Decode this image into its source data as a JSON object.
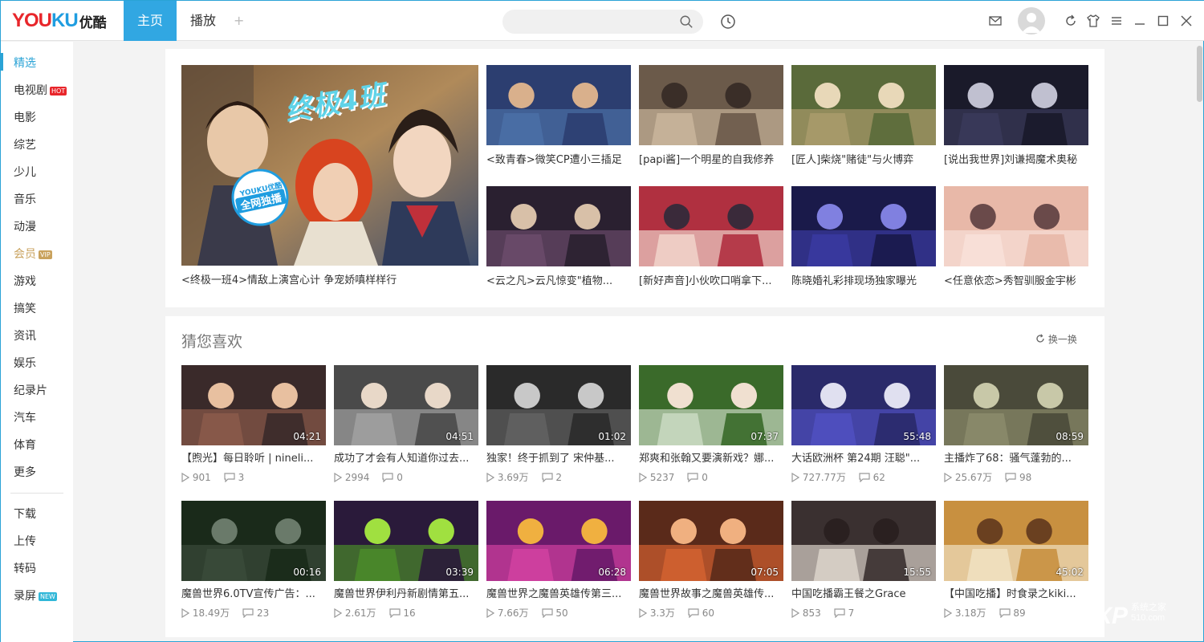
{
  "app": {
    "brand": "YOUKU",
    "brand_cn": "优酷",
    "tabs": [
      {
        "label": "主页",
        "active": true
      },
      {
        "label": "播放",
        "active": false
      }
    ],
    "add_tab": "+",
    "search_placeholder": ""
  },
  "sidebar": {
    "items": [
      {
        "label": "精选",
        "active": true
      },
      {
        "label": "电视剧",
        "badge": "HOT",
        "badge_color": "#e8262b"
      },
      {
        "label": "电影"
      },
      {
        "label": "综艺"
      },
      {
        "label": "少儿"
      },
      {
        "label": "音乐"
      },
      {
        "label": "动漫"
      },
      {
        "label": "会员",
        "badge": "VIP",
        "badge_color": "#c9a25d",
        "vip": true
      },
      {
        "label": "游戏"
      },
      {
        "label": "搞笑"
      },
      {
        "label": "资讯"
      },
      {
        "label": "娱乐"
      },
      {
        "label": "纪录片"
      },
      {
        "label": "汽车"
      },
      {
        "label": "体育"
      },
      {
        "label": "更多"
      },
      {
        "label": "下载"
      },
      {
        "label": "上传"
      },
      {
        "label": "转码"
      },
      {
        "label": "录屏",
        "badge": "NEW",
        "badge_color": "#31b7d8"
      }
    ]
  },
  "featured": {
    "hero": {
      "caption": "<终极一班4>情敌上演宫心计 争宠娇嗔样样行",
      "overlay_title": "终极4班",
      "stamp_top": "YOUKU优酷",
      "stamp_main": "全网独播"
    },
    "items": [
      {
        "caption": "<致青春>微笑CP遭小三插足"
      },
      {
        "caption": "[papi酱]一个明星的自我修养"
      },
      {
        "caption": "[匠人]柴烧\"赌徒\"与火博弈"
      },
      {
        "caption": "[说出我世界]刘谦揭魔术奥秘"
      },
      {
        "caption": "<云之凡>云凡惊变\"植物..."
      },
      {
        "caption": "[新好声音]小伙吹口哨拿下..."
      },
      {
        "caption": "陈晓婚礼彩排现场独家曝光"
      },
      {
        "caption": "<任意依恋>秀智驯服金宇彬"
      }
    ]
  },
  "recommend": {
    "title": "猜您喜欢",
    "refresh_label": "换一换",
    "videos": [
      {
        "title": "【煦光】每日聆听 | nineli...",
        "duration": "04:21",
        "views": "901",
        "comments": "3"
      },
      {
        "title": "成功了才会有人知道你过去...",
        "duration": "04:51",
        "views": "2994",
        "comments": "0"
      },
      {
        "title": "独家！终于抓到了 宋仲基...",
        "duration": "01:02",
        "views": "3.69万",
        "comments": "2"
      },
      {
        "title": "郑爽和张翰又要演新戏？娜...",
        "duration": "07:37",
        "views": "5237",
        "comments": "0"
      },
      {
        "title": "大话欧洲杯 第24期 汪聪\"...",
        "duration": "55:48",
        "views": "727.77万",
        "comments": "62"
      },
      {
        "title": "主播炸了68：骚气蓬勃的...",
        "duration": "08:59",
        "views": "25.67万",
        "comments": "98"
      },
      {
        "title": "魔兽世界6.0TV宣传广告：...",
        "duration": "00:16",
        "views": "18.49万",
        "comments": "23"
      },
      {
        "title": "魔兽世界伊利丹新剧情第五...",
        "duration": "03:39",
        "views": "2.61万",
        "comments": "16"
      },
      {
        "title": "魔兽世界之魔兽英雄传第三...",
        "duration": "06:28",
        "views": "7.66万",
        "comments": "50"
      },
      {
        "title": "魔兽世界故事之魔兽英雄传...",
        "duration": "07:05",
        "views": "3.3万",
        "comments": "60"
      },
      {
        "title": "中国吃播霸王餐之Grace",
        "duration": "15:55",
        "views": "853",
        "comments": "7"
      },
      {
        "title": "【中国吃播】时食录之kiki...",
        "duration": "45:02",
        "views": "3.18万",
        "comments": "89"
      }
    ]
  },
  "watermark": {
    "text": "XP",
    "sub1": "系统之家",
    "sub2": "510.com"
  },
  "colors": {
    "accent": "#31a7e2",
    "brand_red": "#e8262b",
    "brand_blue": "#1f9de0",
    "vip_gold": "#c9a25d"
  }
}
